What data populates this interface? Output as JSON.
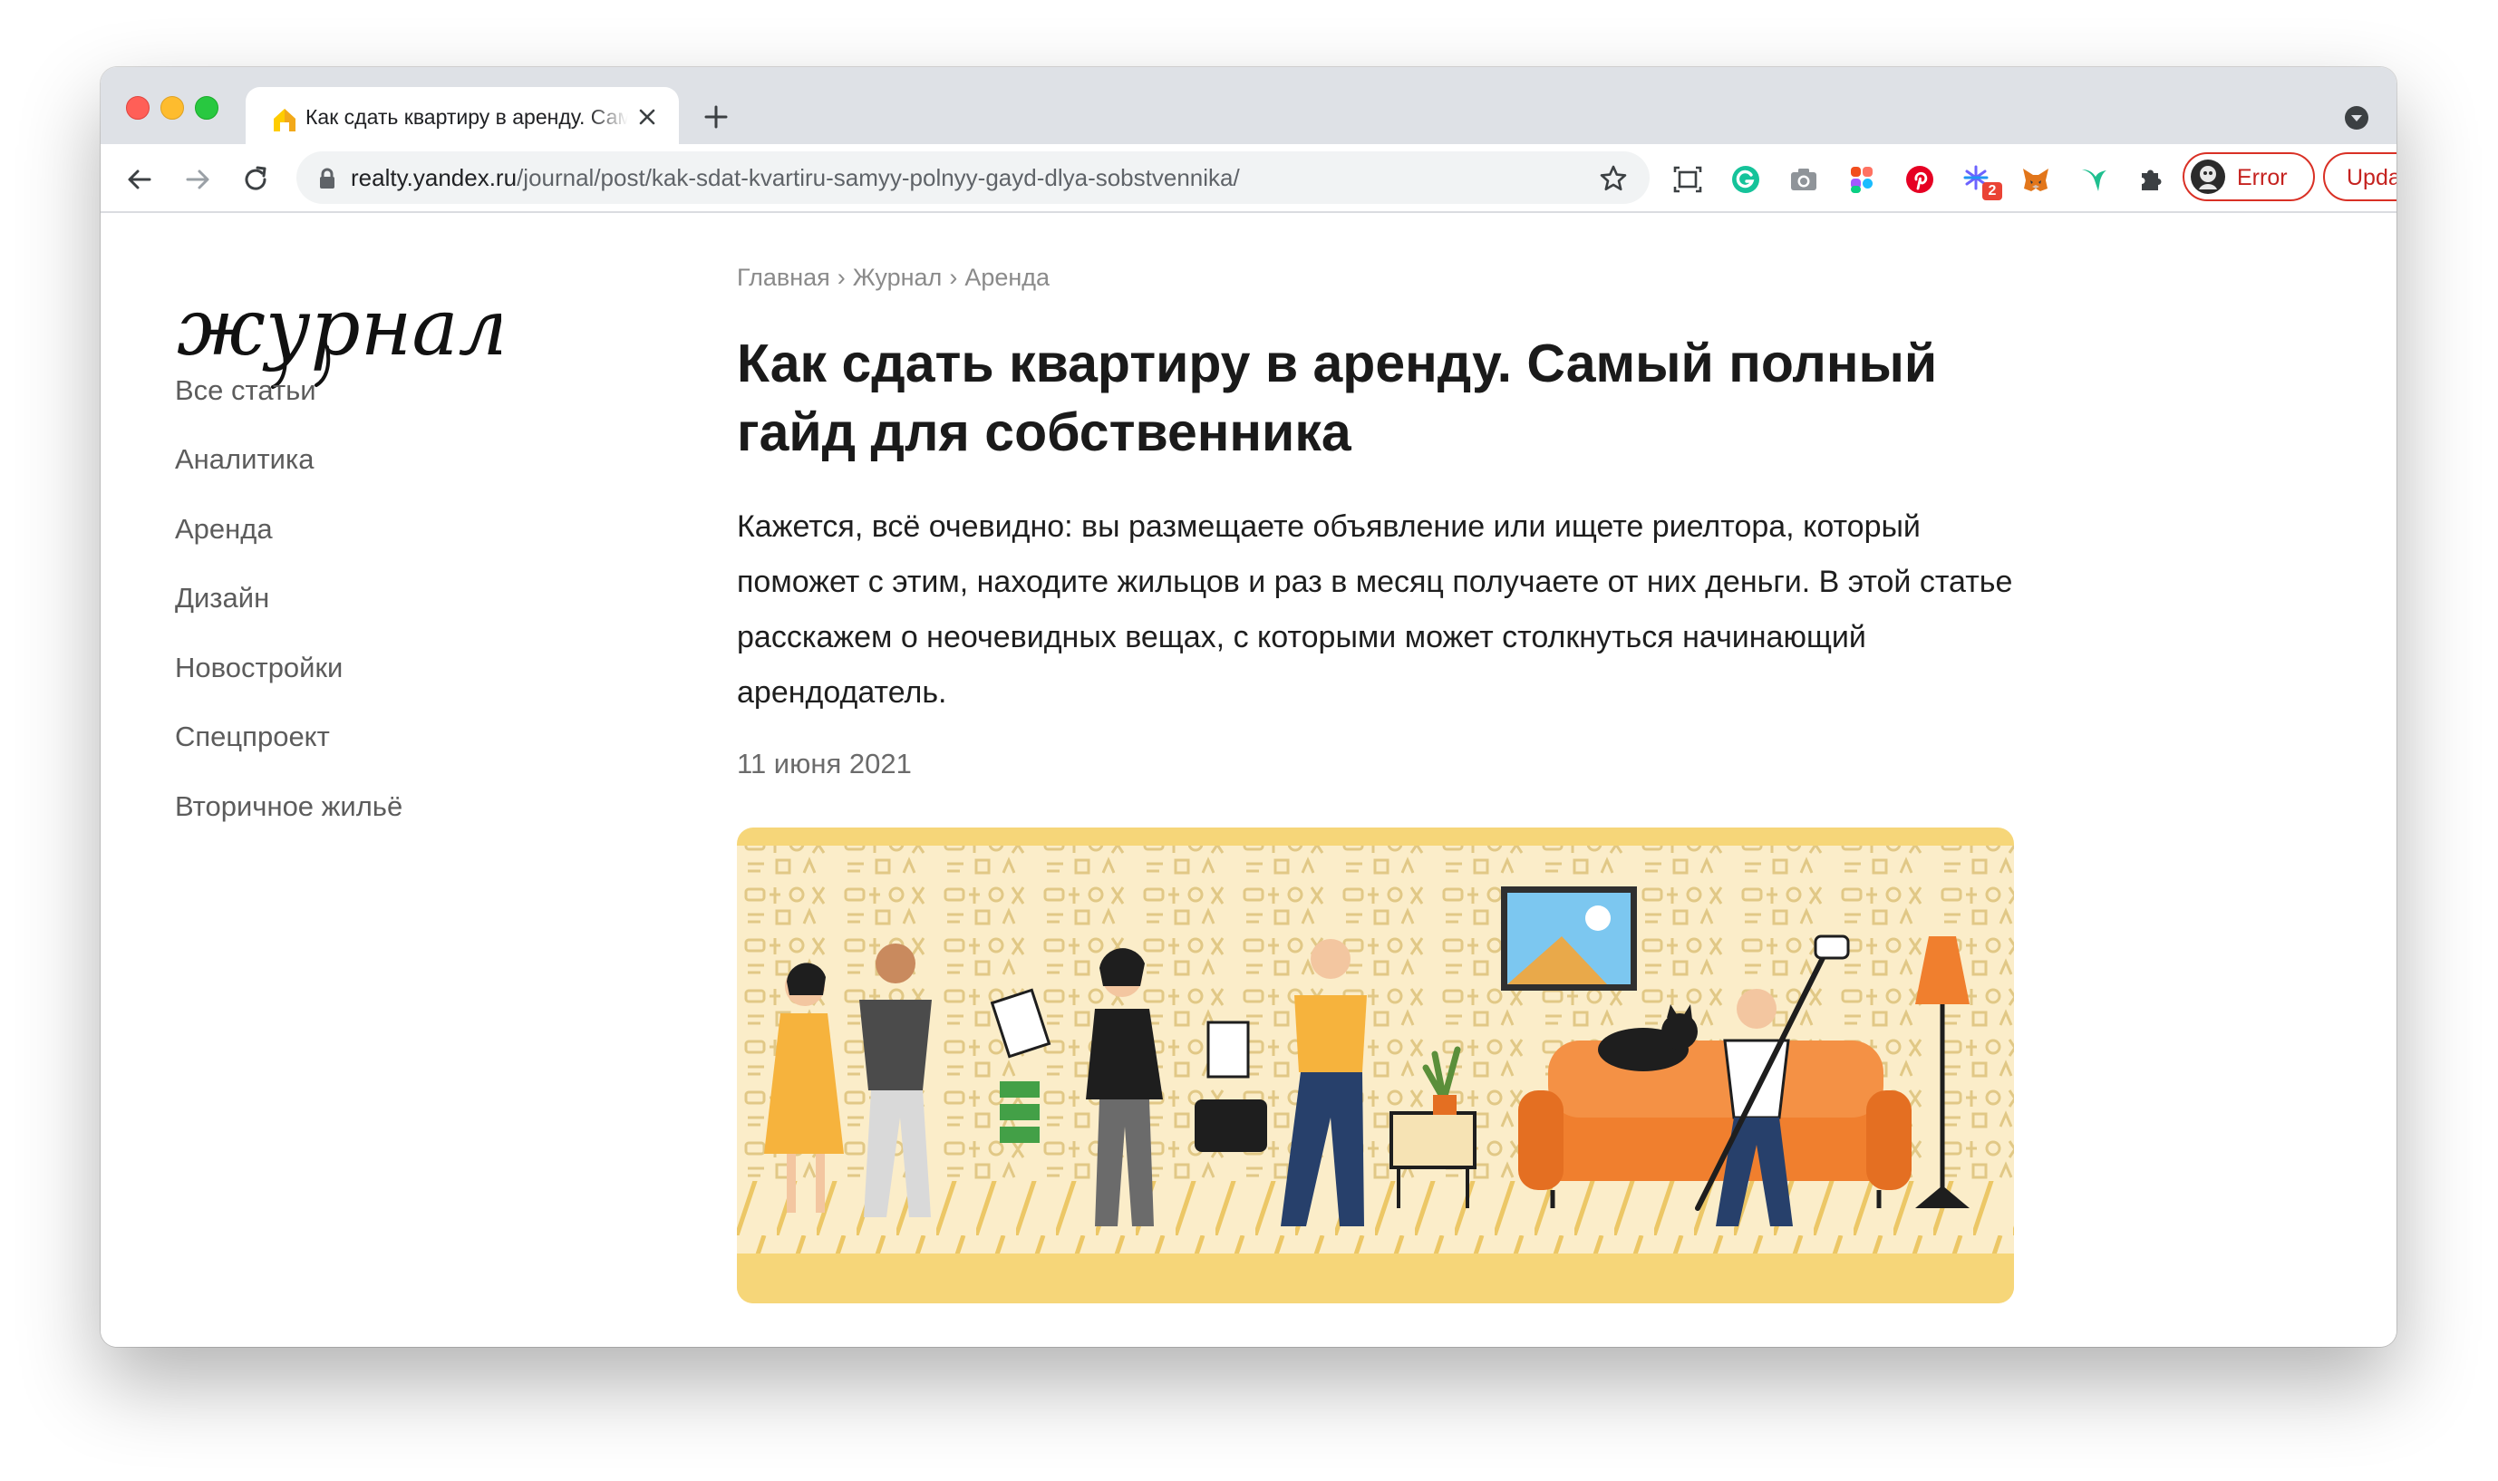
{
  "browser": {
    "tab": {
      "title": "Как сдать квартиру в аренду. Самый полный гайд для собственника"
    },
    "url": {
      "host": "realty.yandex.ru",
      "path": "/journal/post/kak-sdat-kvartiru-samyy-polnyy-gayd-dlya-sobstvennika/"
    },
    "extensions": {
      "badge_count": "2",
      "error_label": "Error",
      "update_label": "Update"
    }
  },
  "site": {
    "logo_text": "журнал",
    "sidebar": {
      "items": [
        {
          "label": "Все статьи"
        },
        {
          "label": "Аналитика"
        },
        {
          "label": "Аренда"
        },
        {
          "label": "Дизайн"
        },
        {
          "label": "Новостройки"
        },
        {
          "label": "Спецпроект"
        },
        {
          "label": "Вторичное жильё"
        }
      ]
    }
  },
  "article": {
    "breadcrumb": {
      "items": [
        "Главная",
        "Журнал",
        "Аренда"
      ],
      "separator": "›"
    },
    "title": "Как сдать квартиру в аренду. Самый полный гайд для собственника",
    "lead": "Кажется, всё очевидно: вы размещаете объявление или ищете риелтора, который поможет с этим, находите жильцов и раз в месяц получаете от них деньги. В этой статье расскажем о неочевидных вещах, с которыми может столкнуться начинающий арендодатель.",
    "date": "11 июня 2021",
    "hero_image": {
      "description_icon": "apartment-rental-illustration"
    }
  },
  "colors": {
    "tabstrip": "#dee1e6",
    "pill_red": "#d93025",
    "hero_background": "#fbedc9",
    "hero_yellow": "#f6d679",
    "sofa_orange": "#f07f2e"
  }
}
